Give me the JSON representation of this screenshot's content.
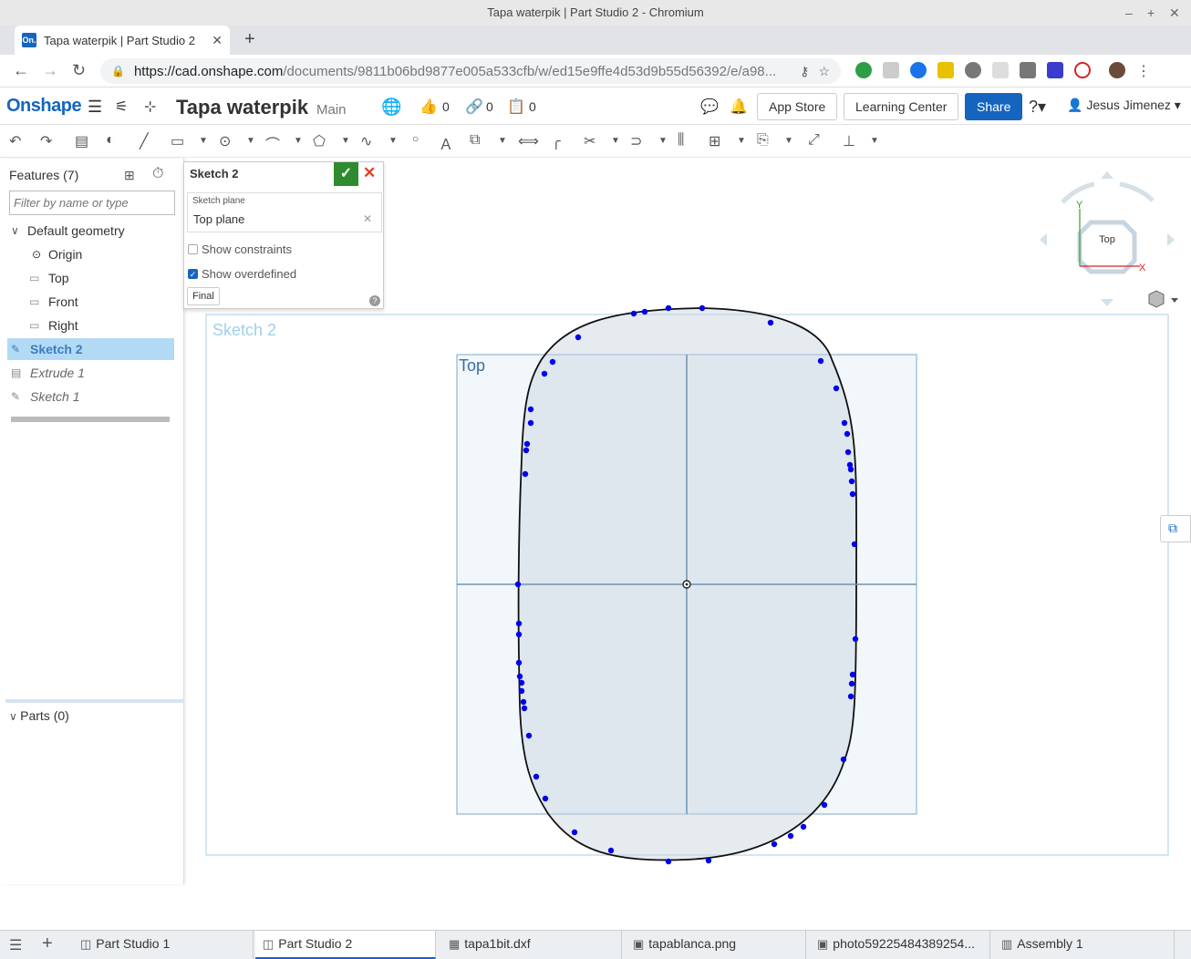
{
  "window": {
    "title": "Tapa waterpik | Part Studio 2 - Chromium"
  },
  "browser": {
    "tab_title": "Tapa waterpik | Part Studio 2",
    "favicon_text": "On.",
    "url_host": "https://cad.onshape.com",
    "url_path": "/documents/9811b06bd9877e005a533cfb/w/ed15e9ffe4d53d9b55d56392/e/a98..."
  },
  "app": {
    "logo": "Onshape",
    "document_title": "Tapa waterpik",
    "branch": "Main",
    "likes": "0",
    "links": "0",
    "copies": "0",
    "app_store": "App Store",
    "learning_center": "Learning Center",
    "share": "Share",
    "user": "Jesus Jimenez"
  },
  "features": {
    "title": "Features (7)",
    "filter_placeholder": "Filter by name or type",
    "default_geometry": "Default geometry",
    "origin": "Origin",
    "top": "Top",
    "front": "Front",
    "right": "Right",
    "sketch2": "Sketch 2",
    "extrude1": "Extrude 1",
    "sketch1": "Sketch 1",
    "parts": "Parts (0)"
  },
  "sketch_dialog": {
    "title": "Sketch 2",
    "plane_label": "Sketch plane",
    "plane_value": "Top plane",
    "show_constraints": "Show constraints",
    "show_overdefined": "Show overdefined",
    "final": "Final",
    "help": "?"
  },
  "viewport": {
    "sketch_label": "Sketch 2",
    "plane_label": "Top",
    "view_cube": "Top",
    "axis_x": "X",
    "axis_y": "Y"
  },
  "bottom_tabs": {
    "t1": "Part Studio 1",
    "t2": "Part Studio 2",
    "t3": "tapa1bit.dxf",
    "t4": "tapablanca.png",
    "t5": "photo59225484389254...",
    "t6": "Assembly 1"
  },
  "colors": {
    "brand": "#1565c0",
    "ok": "#2e8b2e",
    "cancel": "#e0401a",
    "selected_row": "#b3daf5",
    "sketch_point": "#0000ee"
  }
}
